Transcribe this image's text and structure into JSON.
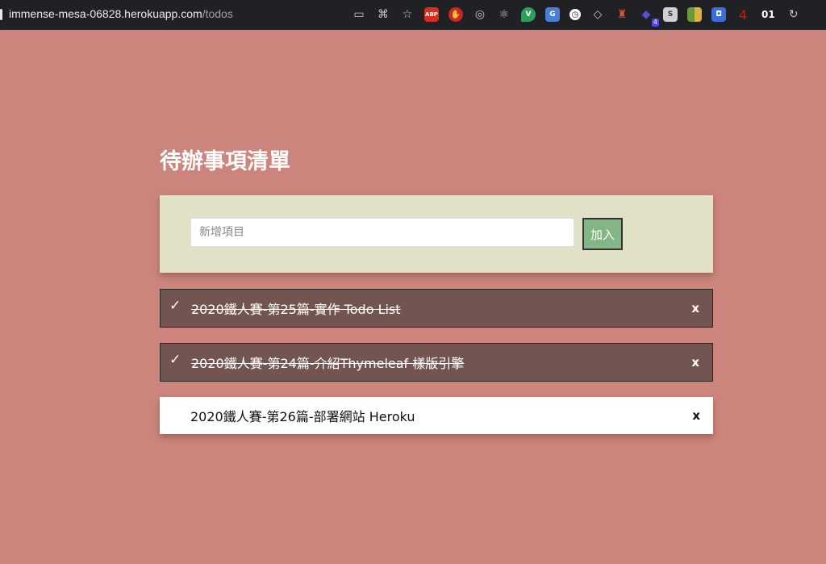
{
  "browser": {
    "url_host": "immense-mesa-06828.herokuapp.com",
    "url_path": "/todos",
    "extensions": [
      {
        "name": "cast-icon",
        "glyph": "▭"
      },
      {
        "name": "translate-icon",
        "glyph": "⌘"
      },
      {
        "name": "bookmark-star-icon",
        "glyph": "☆"
      },
      {
        "name": "adblock-plus-icon",
        "glyph": "ABP",
        "color": "#d62d20"
      },
      {
        "name": "ublock-hand-icon",
        "glyph": "✋",
        "color": "#c62828"
      },
      {
        "name": "target-icon",
        "glyph": "◎"
      },
      {
        "name": "react-devtools-icon",
        "glyph": "⚛"
      },
      {
        "name": "vue-devtools-icon",
        "glyph": "V",
        "color": "#2e9e5a"
      },
      {
        "name": "google-translate-icon",
        "glyph": "G",
        "color": "#4a7fd8"
      },
      {
        "name": "clock-icon",
        "glyph": "◷"
      },
      {
        "name": "diamond-icon",
        "glyph": "◇"
      },
      {
        "name": "fox-icon",
        "glyph": "♜",
        "color": "#d9533b"
      },
      {
        "name": "stack-icon",
        "glyph": "◆",
        "color": "#5b4fcf",
        "badge": "4"
      },
      {
        "name": "s-icon",
        "glyph": "S",
        "color": "#d0d0d0"
      },
      {
        "name": "colorzilla-icon",
        "glyph": "▦",
        "color": "#6a9b3a"
      },
      {
        "name": "blue-box-icon",
        "glyph": "◘",
        "color": "#3b6ed6"
      },
      {
        "name": "four-icon",
        "glyph": "4"
      },
      {
        "name": "counter-icon",
        "glyph": "01"
      },
      {
        "name": "sync-icon",
        "glyph": "↻"
      }
    ]
  },
  "page": {
    "title": "待辦事項清單"
  },
  "add_form": {
    "placeholder": "新增項目",
    "value": "",
    "button_label": "加入"
  },
  "todos": [
    {
      "text": "2020鐵人賽-第25篇-實作 Todo List",
      "done": true,
      "delete_label": "x"
    },
    {
      "text": "2020鐵人賽-第24篇-介紹Thymeleaf 樣版引擎",
      "done": true,
      "delete_label": "x"
    },
    {
      "text": "2020鐵人賽-第26篇-部署網站 Heroku",
      "done": false,
      "delete_label": "x"
    }
  ],
  "check_glyph": "✓",
  "colors": {
    "background": "#cc857c",
    "add_panel": "#e1e1c8",
    "done_item": "#725550",
    "open_item": "#ffffff",
    "add_button": "#84b586"
  }
}
